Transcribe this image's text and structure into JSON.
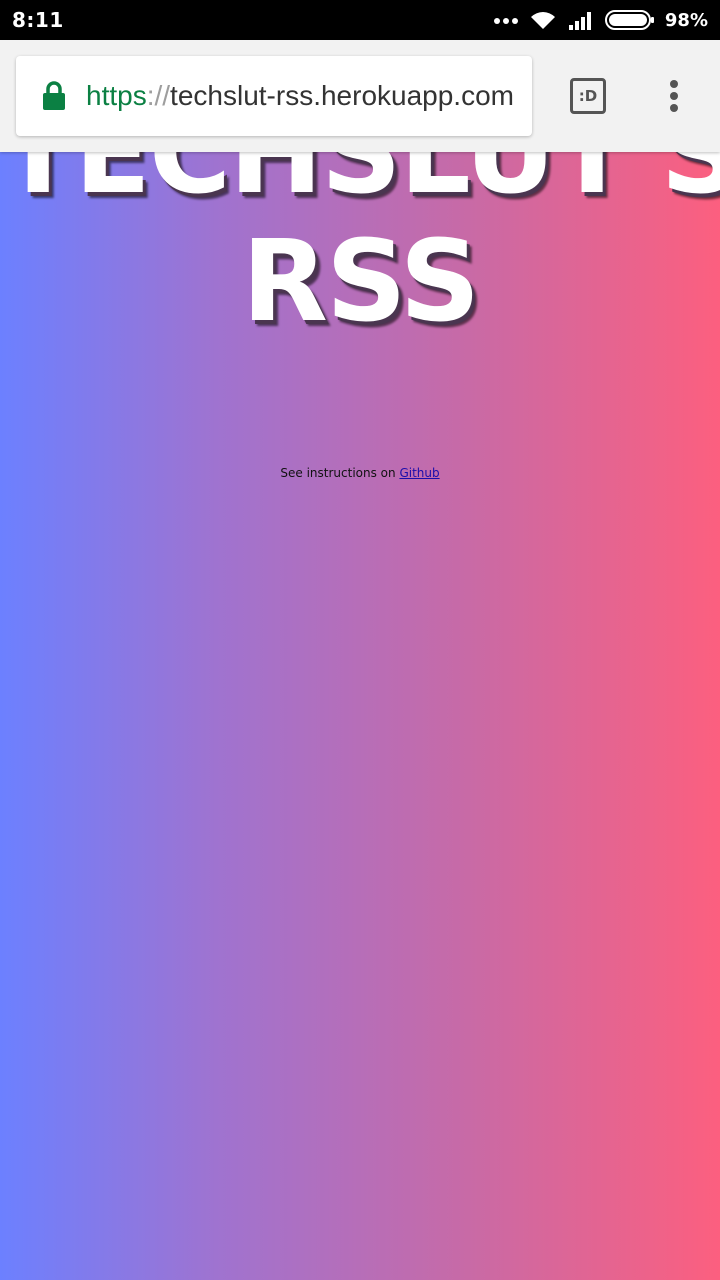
{
  "status_bar": {
    "time": "8:11",
    "battery_percent": "98%",
    "icons": [
      "more-dots-icon",
      "wifi-icon",
      "signal-icon",
      "battery-icon"
    ]
  },
  "browser": {
    "url": {
      "scheme": "https",
      "separator": "://",
      "host": "techslut-rss.herokuapp.com"
    },
    "secure_icon": "lock-icon",
    "secure_color": "#0b8043",
    "tab_switcher_label": ":D",
    "menu_icon": "vertical-dots-icon"
  },
  "page": {
    "title_line1": "TECHSLUT'S",
    "title_line2": "RSS",
    "instructions_prefix": "See instructions on ",
    "instructions_link": "Github",
    "gradient": [
      "#6c80ff",
      "#fc5f7f"
    ]
  }
}
